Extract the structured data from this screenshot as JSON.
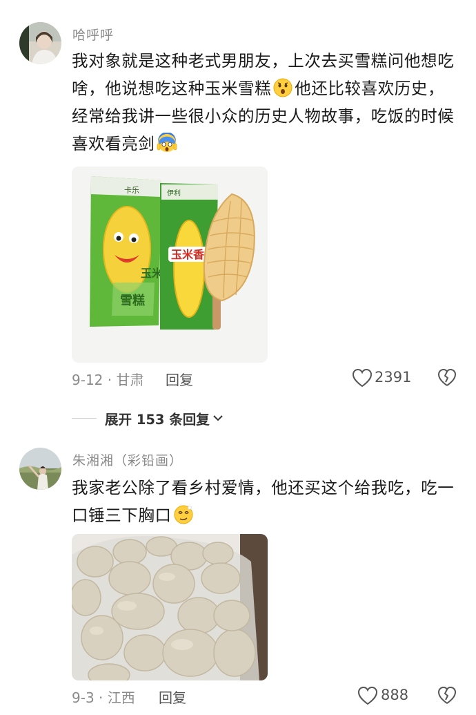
{
  "comments": [
    {
      "username": "哈呼呼",
      "text_before_emoji_1": "我对象就是这种老式男朋友，上次去买雪糕问他想吃啥，他说想吃这种玉米雪糕",
      "text_after_emoji_1": "他还比较喜欢历史，经常给我讲一些很小众的历史人物故事，吃饭的时候喜欢看亮剑",
      "emoji_1": "astonished-face-icon",
      "emoji_2": "screaming-face-icon",
      "image_alt": "corn-ice-cream-products",
      "date_location": "9-12 · 甘肃",
      "reply_label": "回复",
      "likes": "2391",
      "expand_replies": "展开 153 条回复"
    },
    {
      "username": "朱湘湘（彩铅画）",
      "text": "我家老公除了看乡村爱情，他还买这个给我吃，吃一口锤三下胸口",
      "emoji_1": "dizzy-face-icon",
      "image_alt": "bag-of-hard-buns",
      "date_location": "9-3 · 江西",
      "reply_label": "回复",
      "likes": "888"
    }
  ],
  "colors": {
    "meta_gray": "#8a8a8a",
    "text": "#1a1a1a",
    "wrapper_green": "#7cc543",
    "corn_yellow": "#f2c94c"
  }
}
